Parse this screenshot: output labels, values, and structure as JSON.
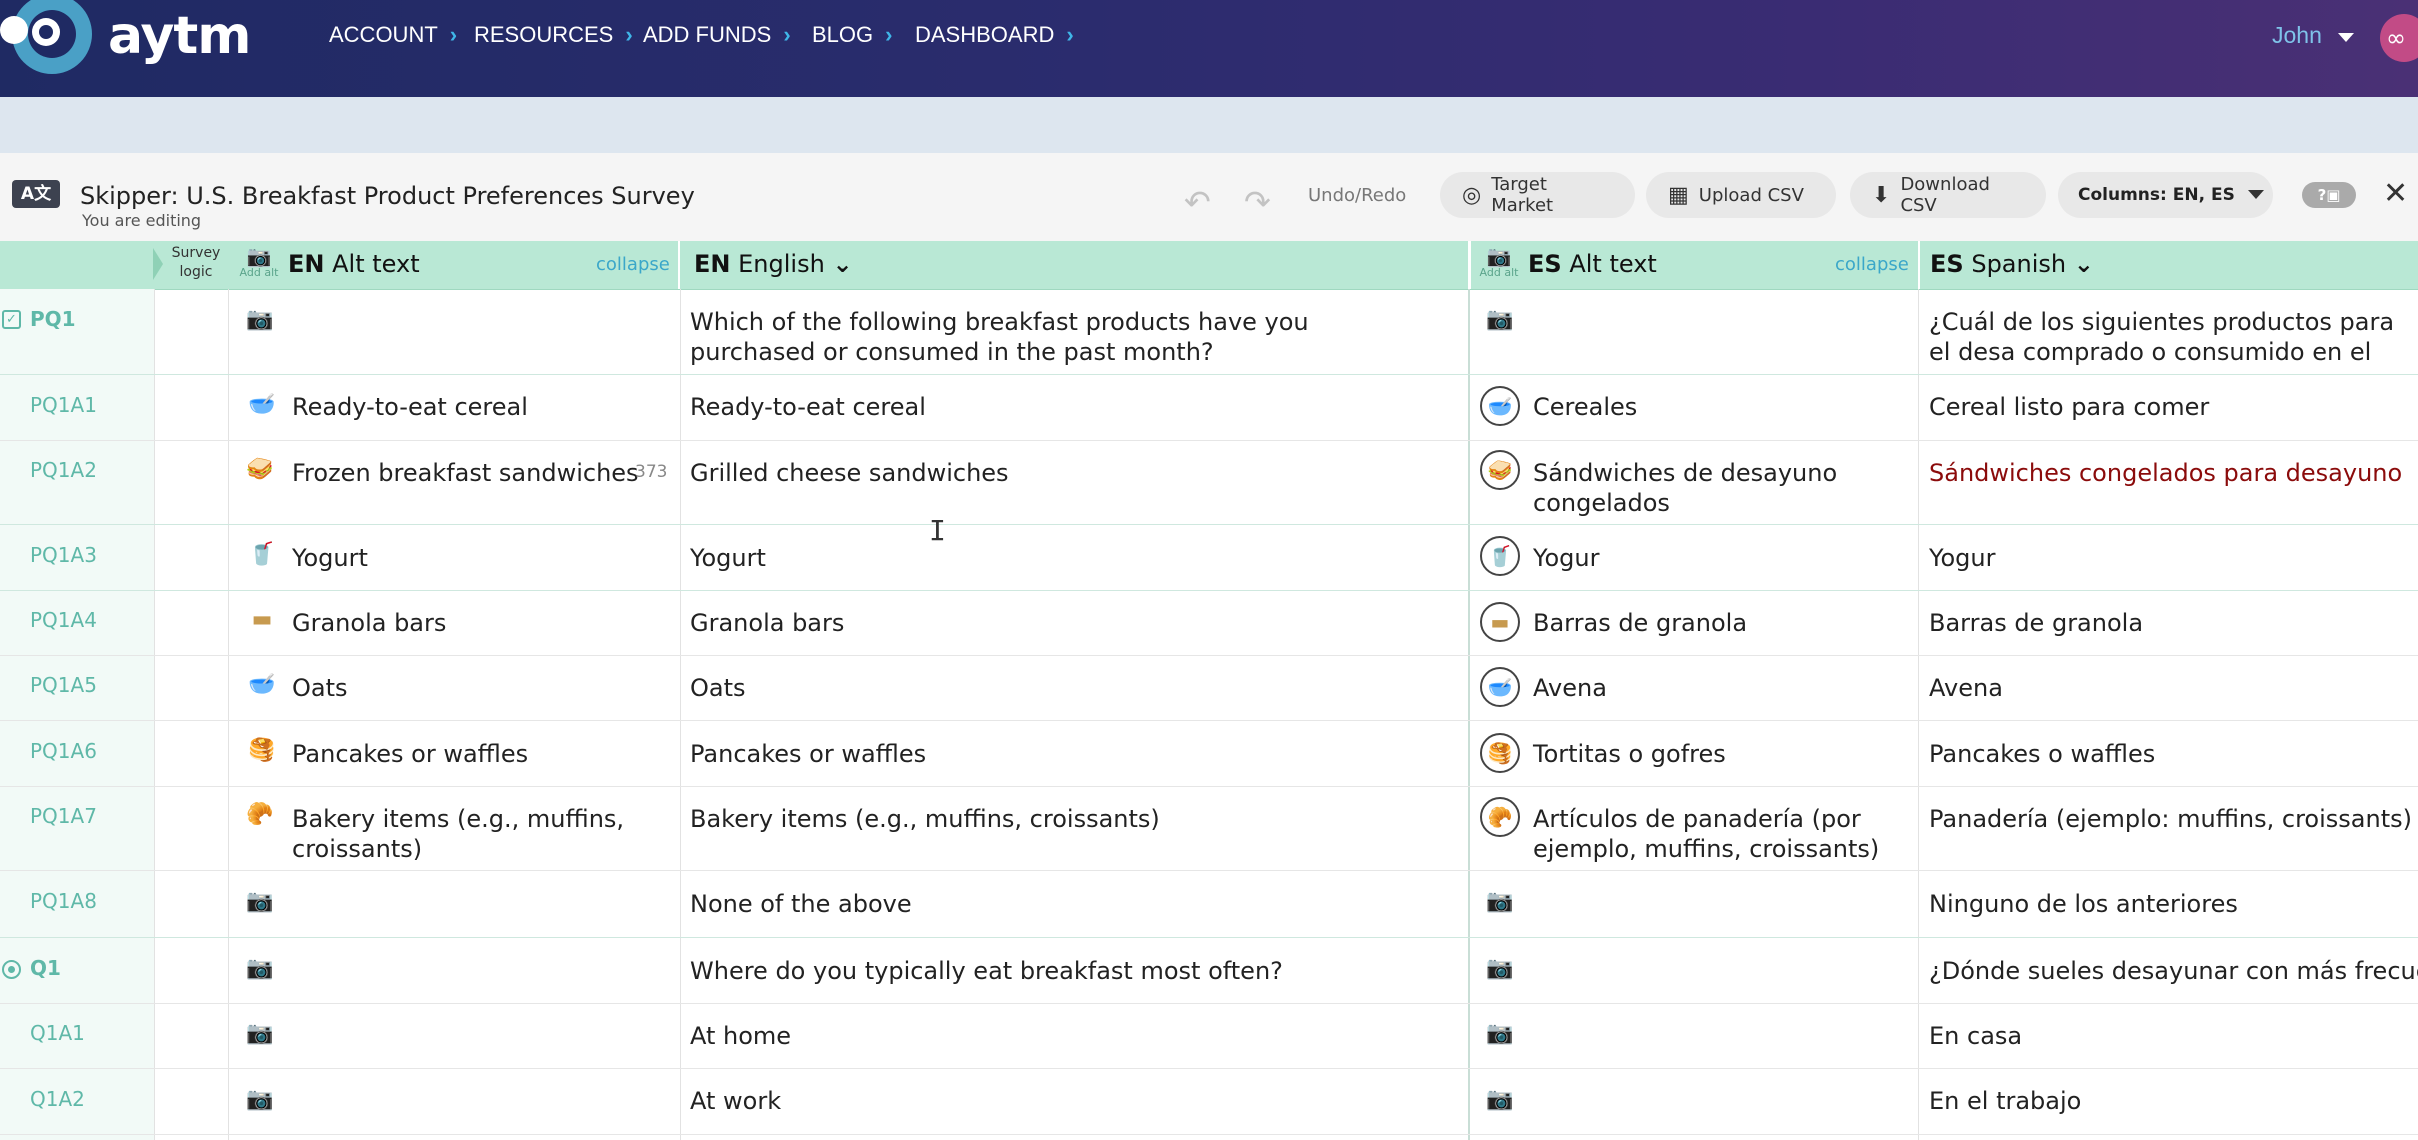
{
  "nav": {
    "brand": "aytm",
    "items": [
      "ACCOUNT",
      "RESOURCES",
      "ADD FUNDS",
      "BLOG",
      "DASHBOARD"
    ],
    "user": "John"
  },
  "editor": {
    "title": "Skipper: U.S. Breakfast Product Preferences Survey",
    "subtitle": "You are editing",
    "undo_label": "Undo/Redo",
    "target_market": "Target Market",
    "upload_csv": "Upload CSV",
    "download_csv": "Download CSV",
    "columns_label": "Columns: EN, ES"
  },
  "header": {
    "survey_logic": "Survey logic",
    "add_alt": "Add alt",
    "en_code": "EN",
    "en_alt_title": "Alt text",
    "collapse": "collapse",
    "en_lang_title": "English",
    "es_code": "ES",
    "es_alt_title": "Alt text",
    "es_lang_title": "Spanish"
  },
  "rows": [
    {
      "id": "PQ1",
      "en_alt": "",
      "en": "Which of the following breakfast products have you purchased or consumed in the past month?",
      "es_alt": "",
      "es": "¿Cuál de los siguientes productos para el desa comprado o consumido en el último mes?"
    },
    {
      "id": "PQ1A1",
      "en_alt": "Ready-to-eat cereal",
      "en": "Ready-to-eat cereal",
      "es_alt": "Cereales",
      "es": "Cereal listo para comer",
      "icon": "🥣"
    },
    {
      "id": "PQ1A2",
      "en_alt": "Frozen breakfast sandwiches",
      "count": "373",
      "en": "Grilled cheese sandwiches",
      "es_alt": "Sándwiches de desayuno congelados",
      "es": "Sándwiches congelados para desayuno",
      "icon": "🥪"
    },
    {
      "id": "PQ1A3",
      "en_alt": "Yogurt",
      "en": "Yogurt",
      "es_alt": "Yogur",
      "es": "Yogur",
      "icon": "🥤"
    },
    {
      "id": "PQ1A4",
      "en_alt": "Granola bars",
      "en": "Granola bars",
      "es_alt": "Barras de granola",
      "es": "Barras de granola",
      "icon": "▬"
    },
    {
      "id": "PQ1A5",
      "en_alt": "Oats",
      "en": "Oats",
      "es_alt": "Avena",
      "es": "Avena",
      "icon": "🥣"
    },
    {
      "id": "PQ1A6",
      "en_alt": "Pancakes or waffles",
      "en": "Pancakes or waffles",
      "es_alt": "Tortitas o gofres",
      "es": "Pancakes o waffles",
      "icon": "🥞"
    },
    {
      "id": "PQ1A7",
      "en_alt": "Bakery items (e.g., muffins, croissants)",
      "en": "Bakery items (e.g., muffins, croissants)",
      "es_alt": "Artículos de panadería (por ejemplo, muffins, croissants)",
      "es": "Panadería (ejemplo: muffins, croissants)",
      "icon": "🥐"
    },
    {
      "id": "PQ1A8",
      "en_alt": "",
      "en": "None of the above",
      "es_alt": "",
      "es": "Ninguno de los anteriores"
    },
    {
      "id": "Q1",
      "en_alt": "",
      "en": "Where do you typically eat breakfast most often?",
      "es_alt": "",
      "es": "¿Dónde sueles desayunar con más frecuencia"
    },
    {
      "id": "Q1A1",
      "en_alt": "",
      "en": "At home",
      "es_alt": "",
      "es": "En casa"
    },
    {
      "id": "Q1A2",
      "en_alt": "",
      "en": "At work",
      "es_alt": "",
      "es": "En el trabajo"
    }
  ]
}
